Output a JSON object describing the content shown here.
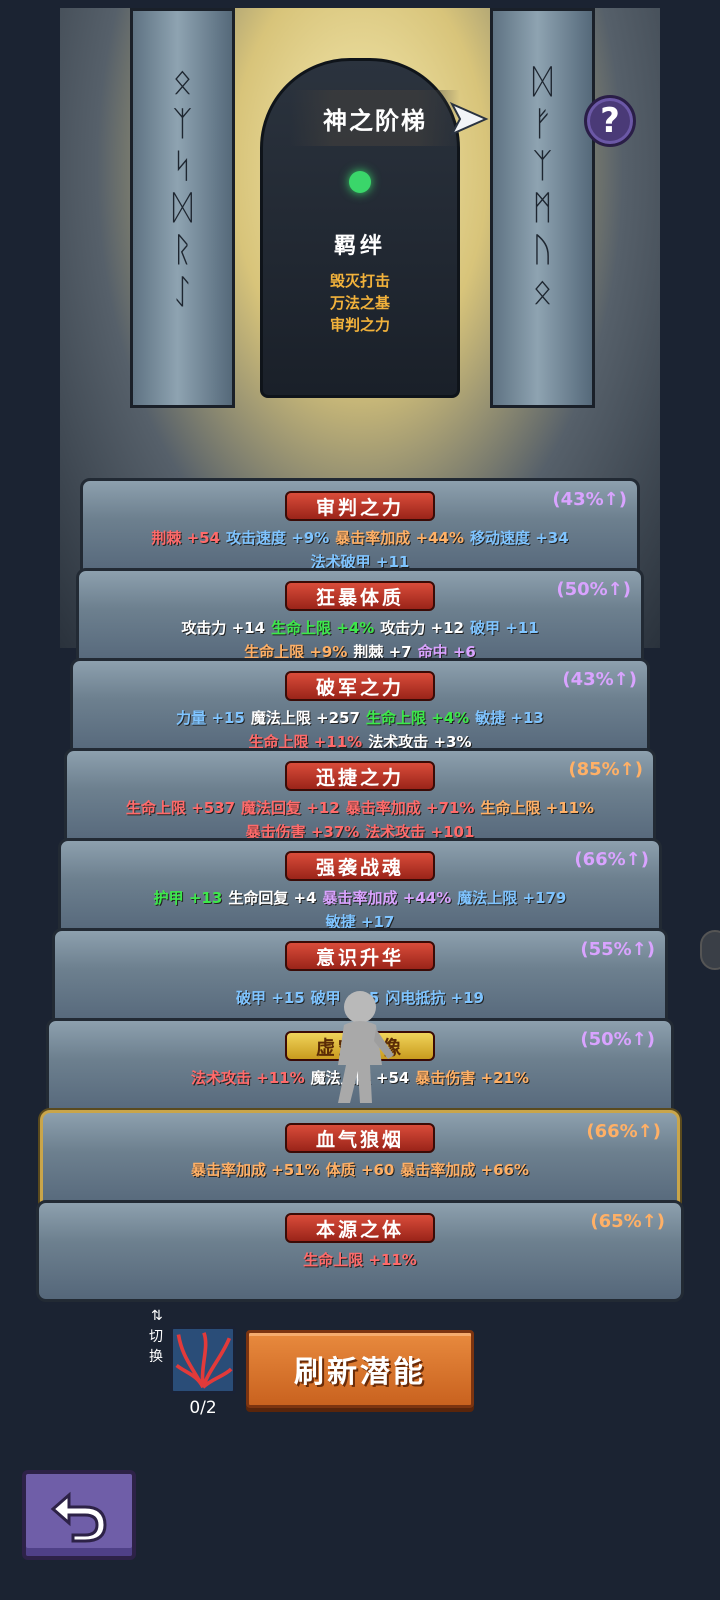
{
  "header": {
    "title": "神之阶梯",
    "share_icon": "send-arrow-icon",
    "help_icon": "help-icon",
    "help_glyph": "?"
  },
  "bond": {
    "title": "羁绊",
    "items": [
      "毁灭打击",
      "万法之基",
      "审判之力"
    ]
  },
  "steps": [
    {
      "title": "审判之力",
      "percent": "(43%↑)",
      "line1": [
        {
          "t": "荆棘 +54",
          "c": "#ff6a6a"
        },
        {
          "t": "攻击速度 +9%",
          "c": "#7fc4ff"
        },
        {
          "t": "暴击率加成 +44%",
          "c": "#ffb066"
        },
        {
          "t": "移动速度 +34",
          "c": "#7fc4ff"
        }
      ],
      "line2": [
        {
          "t": "法术破甲 +11",
          "c": "#7fc4ff"
        }
      ]
    },
    {
      "title": "狂暴体质",
      "percent": "(50%↑)",
      "line1": [
        {
          "t": "攻击力 +14",
          "c": "#ffffff"
        },
        {
          "t": "生命上限 +4%",
          "c": "#3de84b"
        },
        {
          "t": "攻击力 +12",
          "c": "#ffffff"
        },
        {
          "t": "破甲 +11",
          "c": "#7fc4ff"
        }
      ],
      "line2": [
        {
          "t": "生命上限 +9%",
          "c": "#ffb066"
        },
        {
          "t": "荆棘 +7",
          "c": "#ffffff"
        },
        {
          "t": "命中 +6",
          "c": "#d9a3ff"
        }
      ]
    },
    {
      "title": "破军之力",
      "percent": "(43%↑)",
      "line1": [
        {
          "t": "力量 +15",
          "c": "#7fc4ff"
        },
        {
          "t": "魔法上限 +257",
          "c": "#ffffff"
        },
        {
          "t": "生命上限 +4%",
          "c": "#3de84b"
        },
        {
          "t": "敏捷 +13",
          "c": "#7fc4ff"
        }
      ],
      "line2": [
        {
          "t": "生命上限 +11%",
          "c": "#ff6a6a"
        },
        {
          "t": "法术攻击 +3%",
          "c": "#ffffff"
        }
      ]
    },
    {
      "title": "迅捷之力",
      "percent": "(85%↑)",
      "line1": [
        {
          "t": "生命上限 +537",
          "c": "#ff6a6a"
        },
        {
          "t": "魔法回复 +12",
          "c": "#ff6a6a"
        },
        {
          "t": "暴击率加成 +71%",
          "c": "#ff6a6a"
        },
        {
          "t": "生命上限 +11%",
          "c": "#ffb066"
        }
      ],
      "line2": [
        {
          "t": "暴击伤害 +37%",
          "c": "#ff6a6a"
        },
        {
          "t": "法术攻击 +101",
          "c": "#ff6a6a"
        }
      ]
    },
    {
      "title": "强袭战魂",
      "percent": "(66%↑)",
      "line1": [
        {
          "t": "护甲 +13",
          "c": "#3de84b"
        },
        {
          "t": "生命回复 +4",
          "c": "#ffffff"
        },
        {
          "t": "暴击率加成 +44%",
          "c": "#d9a3ff"
        },
        {
          "t": "魔法上限 +179",
          "c": "#7fc4ff"
        }
      ],
      "line2": [
        {
          "t": "敏捷 +17",
          "c": "#7fc4ff"
        }
      ]
    },
    {
      "title": "意识升华",
      "percent": "(55%↑)",
      "line1": [
        {
          "t": "破甲 +15",
          "c": "#7fc4ff"
        },
        {
          "t": "破甲 +15",
          "c": "#7fc4ff"
        },
        {
          "t": "闪电抵抗 +19",
          "c": "#7fc4ff"
        }
      ],
      "line2": []
    },
    {
      "title": "虚空神像",
      "percent": "(50%↑)",
      "line1": [
        {
          "t": "法术攻击 +11%",
          "c": "#ff6a6a"
        },
        {
          "t": "魔法上限 +54",
          "c": "#ffffff"
        },
        {
          "t": "暴击伤害 +21%",
          "c": "#ffb066"
        }
      ],
      "line2": []
    },
    {
      "title": "血气狼烟",
      "percent": "(66%↑)",
      "line1": [
        {
          "t": "暴击率加成 +51%",
          "c": "#ffb066"
        },
        {
          "t": "体质 +60",
          "c": "#ffb066"
        },
        {
          "t": "暴击率加成 +66%",
          "c": "#ffb066"
        }
      ],
      "line2": []
    },
    {
      "title": "本源之体",
      "percent": "(65%↑)",
      "line1": [
        {
          "t": "生命上限 +11%",
          "c": "#ff6a6a"
        }
      ],
      "line2": []
    }
  ],
  "bottom": {
    "switch_label": "切换",
    "switch_icon": "swap-arrows-icon",
    "item_icon": "red-tentacle-item-icon",
    "item_count": "0/2",
    "refresh_label": "刷新潜能",
    "back_icon": "undo-arrow-icon"
  }
}
